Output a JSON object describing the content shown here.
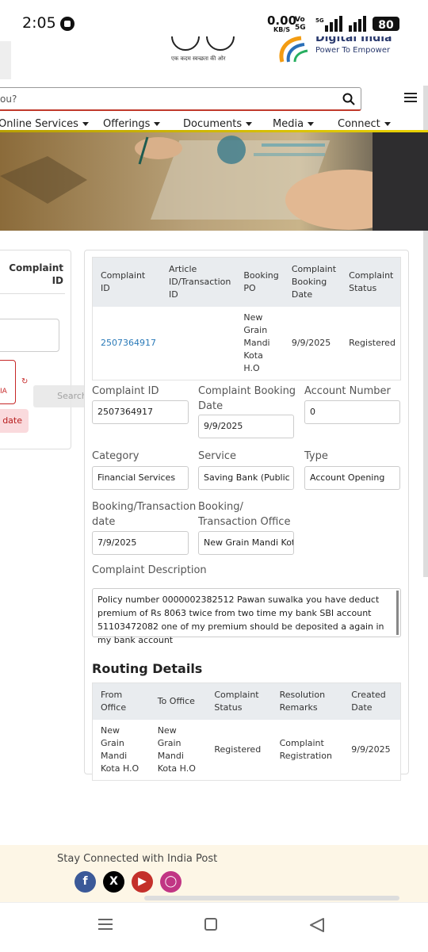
{
  "status_bar": {
    "time": "2:05",
    "net_speed": "0.00",
    "net_unit": "KB/S",
    "volte": "Vo\n5G",
    "network": "5G",
    "battery": "80"
  },
  "header": {
    "swachh_tagline": "एक कदम स्वच्छता की ओर",
    "digital_india_title": "Digital India",
    "digital_india_tagline": "Power To Empower"
  },
  "search": {
    "placeholder": "ou?"
  },
  "nav": {
    "items": [
      "Online Services",
      "Offerings",
      "Documents",
      "Media",
      "Connect"
    ]
  },
  "left_panel": {
    "header": "Complaint ID",
    "captcha_text": "IA",
    "search_label": "Search",
    "validate_label": "date"
  },
  "summary_table": {
    "headers": [
      "Complaint ID",
      "Article ID/Transaction ID",
      "Booking PO",
      "Complaint Booking Date",
      "Complaint Status"
    ],
    "row": [
      "2507364917",
      "",
      "New Grain Mandi Kota H.O",
      "9/9/2025",
      "Registered"
    ]
  },
  "form": {
    "complaint_id_label": "Complaint ID",
    "complaint_id": "2507364917",
    "booking_date_label": "Complaint Booking Date",
    "booking_date": "9/9/2025",
    "account_number_label": "Account Number",
    "account_number": "0",
    "category_label": "Category",
    "category": "Financial Services",
    "service_label": "Service",
    "service": "Saving Bank (Public P",
    "type_label": "Type",
    "type": "Account Opening",
    "txn_date_label": "Booking/Transaction date",
    "txn_date": "7/9/2025",
    "txn_office_label": "Booking/ Transaction Office",
    "txn_office": "New Grain Mandi Kot",
    "description_label": "Complaint Description",
    "description": "Policy number 0000002382512 Pawan suwalka you have deduct premium of Rs 8063 twice from two time my bank SBI account 51103472082 one of my premium should be deposited a again in my bank account"
  },
  "routing": {
    "title": "Routing Details",
    "headers": [
      "From Office",
      "To Office",
      "Complaint Status",
      "Resolution Remarks",
      "Created Date"
    ],
    "row": [
      "New Grain Mandi Kota H.O",
      "New Grain Mandi Kota H.O",
      "Registered",
      "Complaint Registration",
      "9/9/2025"
    ]
  },
  "footer": {
    "text": "Stay Connected with India Post",
    "social_icons": [
      "facebook-icon",
      "x-icon",
      "youtube-icon",
      "instagram-icon"
    ],
    "social_colors": [
      "#3b5998",
      "#000000",
      "#c4302b",
      "#c13584"
    ]
  }
}
